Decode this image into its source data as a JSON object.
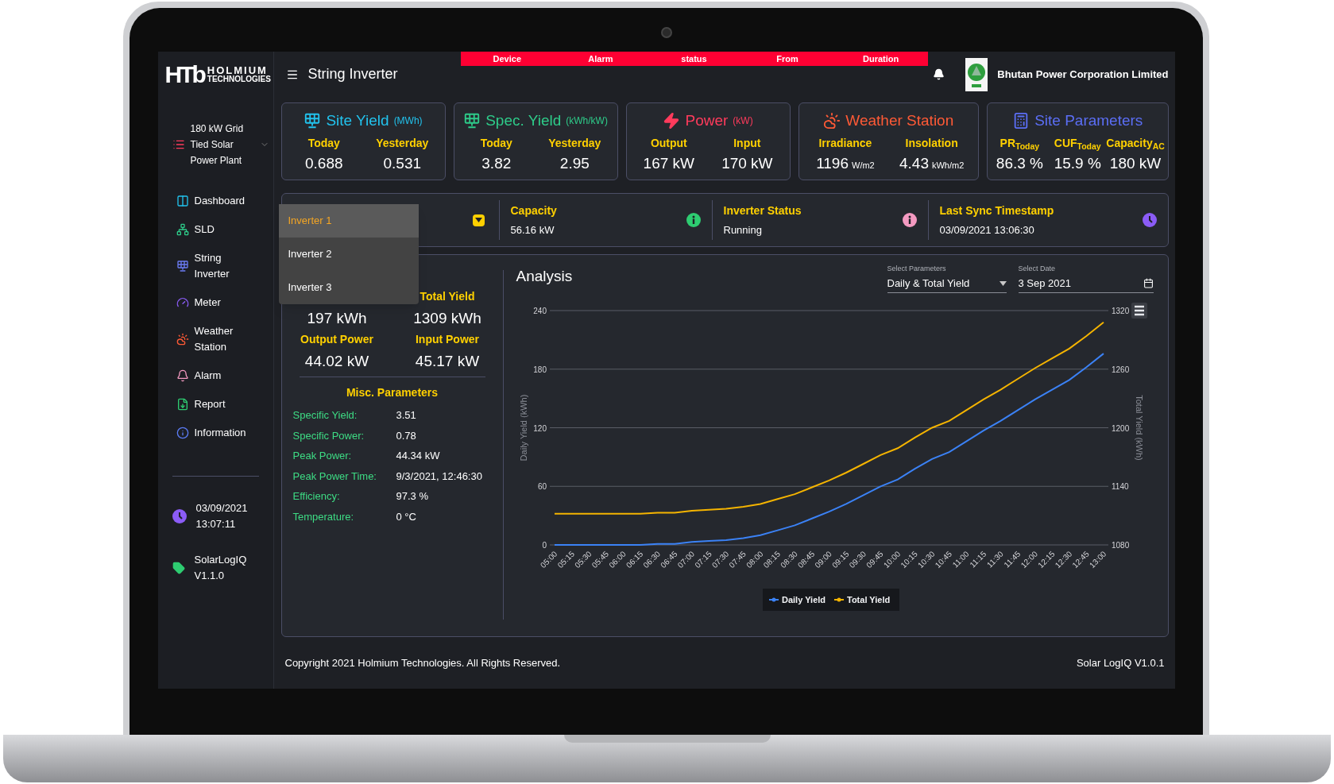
{
  "logo": {
    "mark": "HTb",
    "name_top": "HOLMIUM",
    "name_bottom": "TECHNOLOGIES"
  },
  "sidebar": {
    "plant": "180 kW Grid Tied Solar Power Plant",
    "items": [
      {
        "label": "Dashboard"
      },
      {
        "label": "SLD"
      },
      {
        "label": "String Inverter"
      },
      {
        "label": "Meter"
      },
      {
        "label": "Weather Station"
      },
      {
        "label": "Alarm"
      },
      {
        "label": "Report"
      },
      {
        "label": "Information"
      }
    ],
    "datetime": "03/09/2021 13:07:11",
    "version": "SolarLogIQ V1.1.0"
  },
  "header": {
    "title": "String Inverter",
    "alarm_columns": [
      "Device",
      "Alarm",
      "status",
      "From",
      "Duration"
    ],
    "company": "Bhutan Power Corporation Limited"
  },
  "cards": [
    {
      "title": "Site Yield",
      "unit": "(MWh)",
      "color": "#22c3ee",
      "metrics": [
        {
          "label": "Today",
          "value": "0.688"
        },
        {
          "label": "Yesterday",
          "value": "0.531"
        }
      ]
    },
    {
      "title": "Spec. Yield",
      "unit": "(kWh/kW)",
      "color": "#2ecc8a",
      "metrics": [
        {
          "label": "Today",
          "value": "3.82"
        },
        {
          "label": "Yesterday",
          "value": "2.95"
        }
      ]
    },
    {
      "title": "Power",
      "unit": "(kW)",
      "color": "#ff3b5c",
      "metrics": [
        {
          "label": "Output",
          "value": "167 kW"
        },
        {
          "label": "Input",
          "value": "170 kW"
        }
      ]
    },
    {
      "title": "Weather Station",
      "color": "#ff5a36",
      "metrics": [
        {
          "label": "Irradiance",
          "value": "1196",
          "unit": "W/m2"
        },
        {
          "label": "Insolation",
          "value": "4.43",
          "unit": "kWh/m2"
        }
      ]
    },
    {
      "title": "Site Parameters",
      "color": "#5b6ef5",
      "metrics": [
        {
          "label": "PR$_{Today}$",
          "value": "86.3 %"
        },
        {
          "label": "CUF$_{Today}$",
          "value": "15.9 %"
        },
        {
          "label": "Capacity$_{AC}$",
          "value": "180 kW"
        }
      ]
    }
  ],
  "inverter_info": {
    "select": {
      "options": [
        {
          "label": "Inverter 1",
          "selected": true
        },
        {
          "label": "Inverter 2",
          "selected": false
        },
        {
          "label": "Inverter 3",
          "selected": false
        }
      ]
    },
    "items": [
      {
        "label": "Capacity",
        "value": "56.16 kW",
        "color": "#2ecc71"
      },
      {
        "label": "Inverter Status",
        "value": "Running",
        "color": "#f49ac1"
      },
      {
        "label": "Last Sync Timestamp",
        "value": "03/09/2021 13:06:30",
        "color": "#8b5cf6"
      }
    ]
  },
  "summary": [
    {
      "kind": "heading",
      "cells": [
        "Total Yield"
      ]
    },
    {
      "kind": "value",
      "cells": [
        "197 kWh",
        "1309 kWh"
      ]
    },
    {
      "kind": "heading",
      "cells": [
        "Output Power",
        "Input Power"
      ]
    },
    {
      "kind": "value",
      "cells": [
        "44.02 kW",
        "45.17 kW"
      ]
    }
  ],
  "misc": {
    "title": "Misc. Parameters",
    "rows": [
      {
        "label": "Specific Yield:",
        "value": "3.51"
      },
      {
        "label": "Specific Power:",
        "value": "0.78"
      },
      {
        "label": "Peak Power:",
        "value": "44.34 kW"
      },
      {
        "label": "Peak Power Time:",
        "value": "9/3/2021, 12:46:30"
      },
      {
        "label": "Efficiency:",
        "value": "97.3 %"
      },
      {
        "label": "Temperature:",
        "value": "0 °C"
      }
    ]
  },
  "analysis": {
    "title": "Analysis",
    "parameter_field": {
      "label": "Select Parameters",
      "value": "Daily & Total Yield"
    },
    "date_field": {
      "label": "Select Date",
      "value": "3 Sep 2021"
    },
    "chart_data": {
      "type": "line",
      "grid": true,
      "legend": "bottom",
      "ylabel": "Daily Yield (kWh)",
      "y2label": "Total Yield (kWh)",
      "ylim": [
        0,
        240
      ],
      "yticks": [
        0,
        60,
        120,
        180,
        240
      ],
      "y2lim": [
        1080,
        1320
      ],
      "y2ticks": [
        1080,
        1140,
        1200,
        1260,
        1320
      ],
      "categories": [
        "05:00",
        "05:15",
        "05:30",
        "05:45",
        "06:00",
        "06:15",
        "06:30",
        "06:45",
        "07:00",
        "07:15",
        "07:30",
        "07:45",
        "08:00",
        "08:15",
        "08:30",
        "08:45",
        "09:00",
        "09:15",
        "09:30",
        "09:45",
        "10:00",
        "10:15",
        "10:30",
        "10:45",
        "11:00",
        "11:15",
        "11:30",
        "11:45",
        "12:00",
        "12:15",
        "12:30",
        "12:45",
        "13:00"
      ],
      "series": [
        {
          "name": "Daily Yield",
          "color": "#3b82f6",
          "values": [
            0,
            0,
            0,
            0,
            0,
            0,
            1,
            1,
            3,
            4,
            5,
            7,
            10,
            15,
            20,
            27,
            34,
            42,
            51,
            60,
            67,
            78,
            88,
            95,
            106,
            117,
            127,
            138,
            149,
            159,
            169,
            182,
            196
          ]
        },
        {
          "name": "Total Yield",
          "color": "#f5b400",
          "axis": "y2",
          "values": [
            1112,
            1112,
            1112,
            1112,
            1112,
            1112,
            1113,
            1113,
            1115,
            1116,
            1117,
            1119,
            1122,
            1127,
            1132,
            1139,
            1146,
            1154,
            1163,
            1172,
            1179,
            1190,
            1200,
            1207,
            1218,
            1229,
            1239,
            1250,
            1261,
            1271,
            1281,
            1294,
            1308
          ]
        }
      ]
    }
  },
  "footer": {
    "copyright": "Copyright 2021 Holmium Technologies. All Rights Reserved.",
    "version": "Solar LogIQ V1.0.1"
  }
}
